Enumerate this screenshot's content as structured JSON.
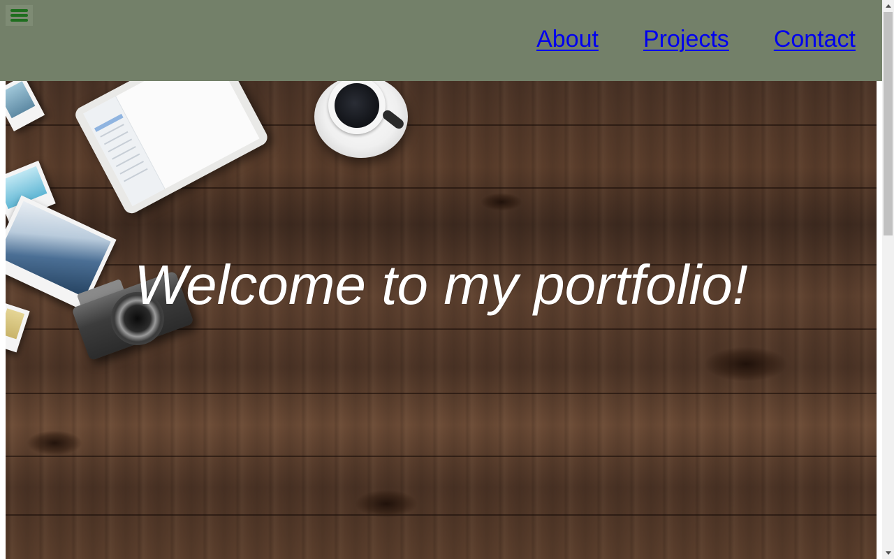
{
  "nav": {
    "menu_icon": "hamburger-menu-icon",
    "links": [
      {
        "label": "About"
      },
      {
        "label": "Projects"
      },
      {
        "label": "Contact"
      }
    ]
  },
  "hero": {
    "title": "Welcome to my portfolio!",
    "background_description_colors": {
      "wood": "#4a3326"
    }
  },
  "colors": {
    "navbar_bg": "#738069",
    "link": "#0000ee",
    "menu_icon": "#1e6e1e",
    "hero_text": "#ffffff"
  }
}
